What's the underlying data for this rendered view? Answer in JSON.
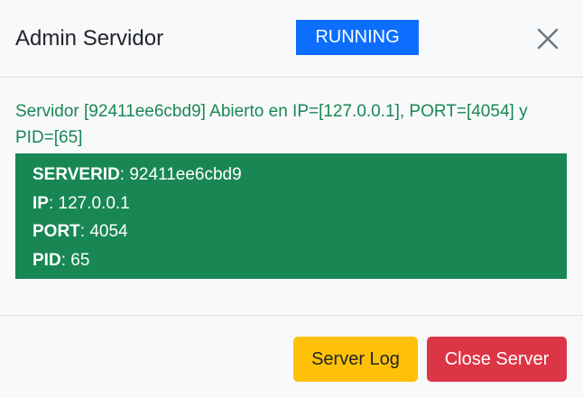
{
  "header": {
    "title": "Admin Servidor",
    "status": "RUNNING",
    "status_color": "#0d6efd"
  },
  "body": {
    "message": "Servidor [92411ee6cbd9] Abierto en IP=[127.0.0.1], PORT=[4054] y PID=[65]",
    "message_color": "#198754",
    "info": [
      {
        "key": "SERVERID",
        "sep": ": ",
        "value": "92411ee6cbd9"
      },
      {
        "key": "IP",
        "sep": ": ",
        "value": "127.0.0.1"
      },
      {
        "key": "PORT",
        "sep": ": ",
        "value": "4054"
      },
      {
        "key": "PID",
        "sep": ": ",
        "value": "65"
      }
    ],
    "info_bg": "#198754"
  },
  "footer": {
    "log_button": "Server Log",
    "close_button": "Close Server"
  },
  "icons": {
    "close": "close-icon"
  }
}
